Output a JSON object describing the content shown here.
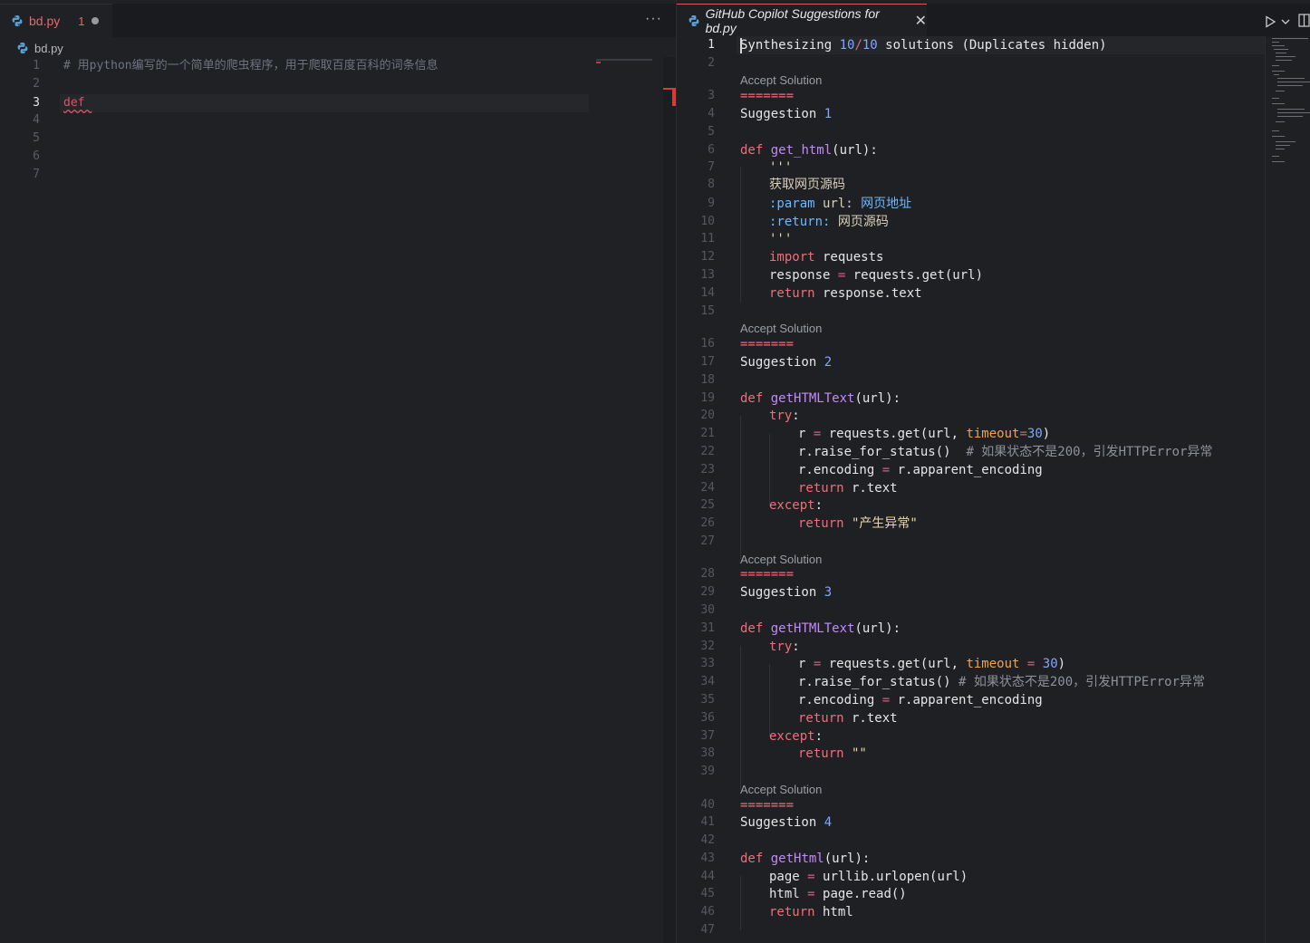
{
  "left": {
    "tab": {
      "name": "bd.py",
      "problems": "1"
    },
    "more_actions": "···",
    "breadcrumb": {
      "file": "bd.py"
    },
    "lines": [
      {
        "num": "1",
        "text": "# 用python编写的一个简单的爬虫程序，用于爬取百度百科的词条信息"
      },
      {
        "num": "2",
        "text": ""
      },
      {
        "num": "3",
        "text": "def "
      },
      {
        "num": "4",
        "text": ""
      },
      {
        "num": "5",
        "text": ""
      },
      {
        "num": "6",
        "text": ""
      },
      {
        "num": "7",
        "text": ""
      }
    ]
  },
  "right": {
    "tab": {
      "name": "GitHub Copilot Suggestions for bd.py",
      "close": "✕"
    },
    "header": {
      "text1": "Synthesizing ",
      "count": "10",
      "slash": "/",
      "total": "10",
      "text2": " solutions (Duplicates hidden)"
    },
    "accept_label": "Accept Solution",
    "separator": "=======",
    "suggestion_word": "Suggestion",
    "s1": {
      "n": "1",
      "def": "def",
      "name": "get_html",
      "sig": "(url):",
      "doc_quote": "'''",
      "doc1": "获取网页源码",
      "doc2a": ":param",
      "doc2b": " url: ",
      "doc2c": "网页地址",
      "doc3a": ":return:",
      "doc3b": " 网页源码",
      "import_kw": "import",
      "import_mod": " requests",
      "resp": "response ",
      "eq": "=",
      "resp2": " requests.get(url)",
      "ret": "return",
      "ret_val": " response.text"
    },
    "s2": {
      "n": "2",
      "def": "def",
      "name": "getHTMLText",
      "sig": "(url):",
      "try": "try",
      "colon": ":",
      "l1a": "r ",
      "eq": "=",
      "l1b": " requests.get(url, ",
      "timeout": "timeout",
      "l1c": "=",
      "l1d": "30",
      "l1e": ")",
      "l2": "r.raise_for_status()  ",
      "l2c": "# 如果状态不是200，引发HTTPError异常",
      "l3a": "r.encoding ",
      "l3b": "=",
      "l3c": " r.apparent_encoding",
      "ret": "return",
      "ret_val": " r.text",
      "except": "except",
      "ret2": "return",
      "ret2_val": " \"产生异常\""
    },
    "s3": {
      "n": "3",
      "def": "def",
      "name": "getHTMLText",
      "sig": "(url):",
      "try": "try",
      "colon": ":",
      "l1a": "r ",
      "eq": "=",
      "l1b": " requests.get(url, ",
      "timeout": "timeout",
      "l1c": " = ",
      "l1d": "30",
      "l1e": ")",
      "l2": "r.raise_for_status() ",
      "l2c": "# 如果状态不是200，引发HTTPError异常",
      "l3a": "r.encoding ",
      "l3b": "=",
      "l3c": " r.apparent_encoding",
      "ret": "return",
      "ret_val": " r.text",
      "except": "except",
      "ret2": "return",
      "ret2_val": " \"\""
    },
    "s4": {
      "n": "4",
      "def": "def",
      "name": "getHtml",
      "sig": "(url):",
      "l1a": "page ",
      "eq": "=",
      "l1b": " urllib.urlopen(url)",
      "l2a": "html ",
      "l2b": " page.read()",
      "ret": "return",
      "ret_val": " html"
    },
    "line_numbers": [
      "1",
      "2",
      "3",
      "4",
      "5",
      "6",
      "7",
      "8",
      "9",
      "10",
      "11",
      "12",
      "13",
      "14",
      "15",
      "16",
      "17",
      "18",
      "19",
      "20",
      "21",
      "22",
      "23",
      "24",
      "25",
      "26",
      "27",
      "28",
      "29",
      "30",
      "31",
      "32",
      "33",
      "34",
      "35",
      "36",
      "37",
      "38",
      "39",
      "40",
      "41",
      "42",
      "43",
      "44",
      "45",
      "46",
      "47"
    ]
  },
  "colors": {
    "background": "#1e2024",
    "keyword": "#f06e7a",
    "function": "#c58af9",
    "number": "#7fa8ff",
    "error": "#e0526a"
  }
}
